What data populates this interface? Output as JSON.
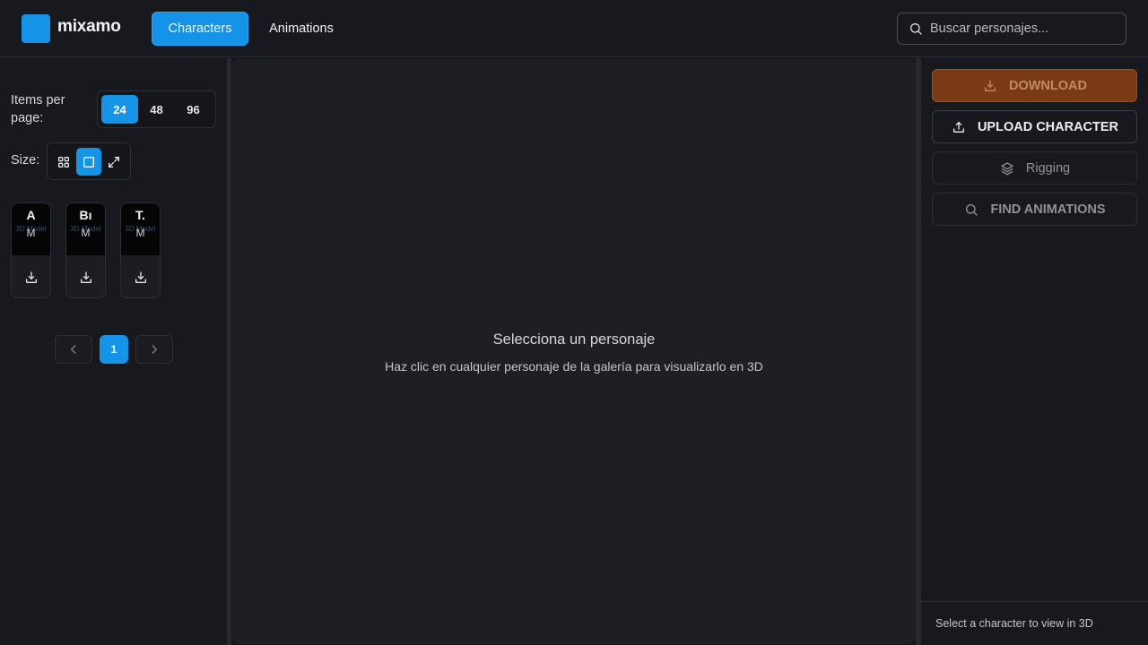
{
  "header": {
    "logo_text": "mixamo",
    "tabs": [
      {
        "label": "Characters",
        "active": true
      },
      {
        "label": "Animations",
        "active": false
      }
    ],
    "search": {
      "placeholder": "Buscar personajes...",
      "value": ""
    }
  },
  "sidebar": {
    "items_per_page_label": "Items per page:",
    "items_per_page_options": [
      "24",
      "48",
      "96"
    ],
    "items_per_page_selected": "24",
    "size_label": "Size:",
    "size_options": [
      "grid-icon",
      "square-icon",
      "expand-icon"
    ],
    "size_selected": "square-icon",
    "cards": [
      {
        "initial": "A",
        "tag": "3D Model",
        "sub": "M"
      },
      {
        "initial": "Bı",
        "tag": "3D Model",
        "sub": "M"
      },
      {
        "initial": "T.",
        "tag": "3D Model",
        "sub": "M"
      }
    ],
    "pagination": {
      "current_page": "1"
    }
  },
  "viewer": {
    "title": "Selecciona un personaje",
    "subtitle": "Haz clic en cualquier personaje de la galería para visualizarlo en 3D"
  },
  "actions": {
    "download_label": "DOWNLOAD",
    "upload_label": "UPLOAD CHARACTER",
    "rigging_label": "Rigging",
    "find_animations_label": "FIND ANIMATIONS"
  },
  "footer": {
    "status": "Select a character to view in 3D"
  },
  "colors": {
    "accent": "#1593e6",
    "download": "#7a3a14",
    "background": "#16181d"
  }
}
